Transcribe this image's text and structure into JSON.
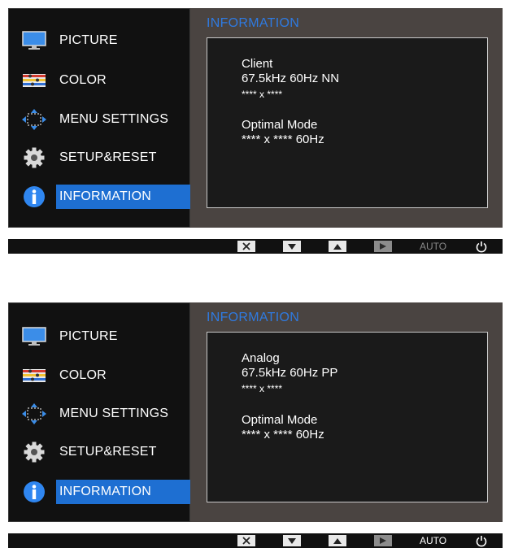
{
  "screens": [
    {
      "menu": [
        {
          "label": "PICTURE",
          "icon": "monitor-icon"
        },
        {
          "label": "COLOR",
          "icon": "color-bars-icon"
        },
        {
          "label": "MENU SETTINGS",
          "icon": "menu-settings-arrows-icon"
        },
        {
          "label": "SETUP&RESET",
          "icon": "gear-icon"
        },
        {
          "label": "INFORMATION",
          "icon": "info-icon",
          "selected": true
        }
      ],
      "info_title": "INFORMATION",
      "signal_type": "Client",
      "frequency": "67.5kHz 60Hz NN",
      "resolution": "**** x ****",
      "optimal_label": "Optimal Mode",
      "optimal_value": "**** x **** 60Hz",
      "keybar": {
        "auto": "AUTO",
        "auto_color": "#8a8a8a"
      }
    },
    {
      "menu": [
        {
          "label": "PICTURE",
          "icon": "monitor-icon"
        },
        {
          "label": "COLOR",
          "icon": "color-bars-icon"
        },
        {
          "label": "MENU SETTINGS",
          "icon": "menu-settings-arrows-icon"
        },
        {
          "label": "SETUP&RESET",
          "icon": "gear-icon"
        },
        {
          "label": "INFORMATION",
          "icon": "info-icon",
          "selected": true
        }
      ],
      "info_title": "INFORMATION",
      "signal_type": "Analog",
      "frequency": "67.5kHz 60Hz PP",
      "resolution": "**** x ****",
      "optimal_label": "Optimal Mode",
      "optimal_value": "**** x **** 60Hz",
      "keybar": {
        "auto": "AUTO",
        "auto_color": "#ffffff"
      }
    }
  ],
  "colors": {
    "accent": "#1e6fd2",
    "title_blue": "#2f7ae0",
    "panel": "#4a4441",
    "menu_bg": "#111111"
  }
}
